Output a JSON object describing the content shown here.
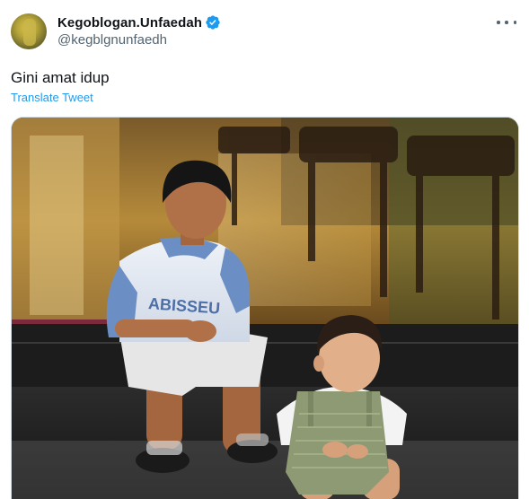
{
  "tweet": {
    "display_name": "Kegoblogan.Unfaedah",
    "handle": "@kegblgnunfaedh",
    "verified": true,
    "text": "Gini amat idup",
    "translate_label": "Translate Tweet",
    "more_icon": "more-horizontal-icon",
    "media": {
      "type": "photo",
      "shirt_text": "ABISSEU"
    }
  },
  "colors": {
    "text_primary": "#0f1419",
    "text_secondary": "#536471",
    "link": "#1d9bf0",
    "verified_badge": "#1d9bf0"
  }
}
